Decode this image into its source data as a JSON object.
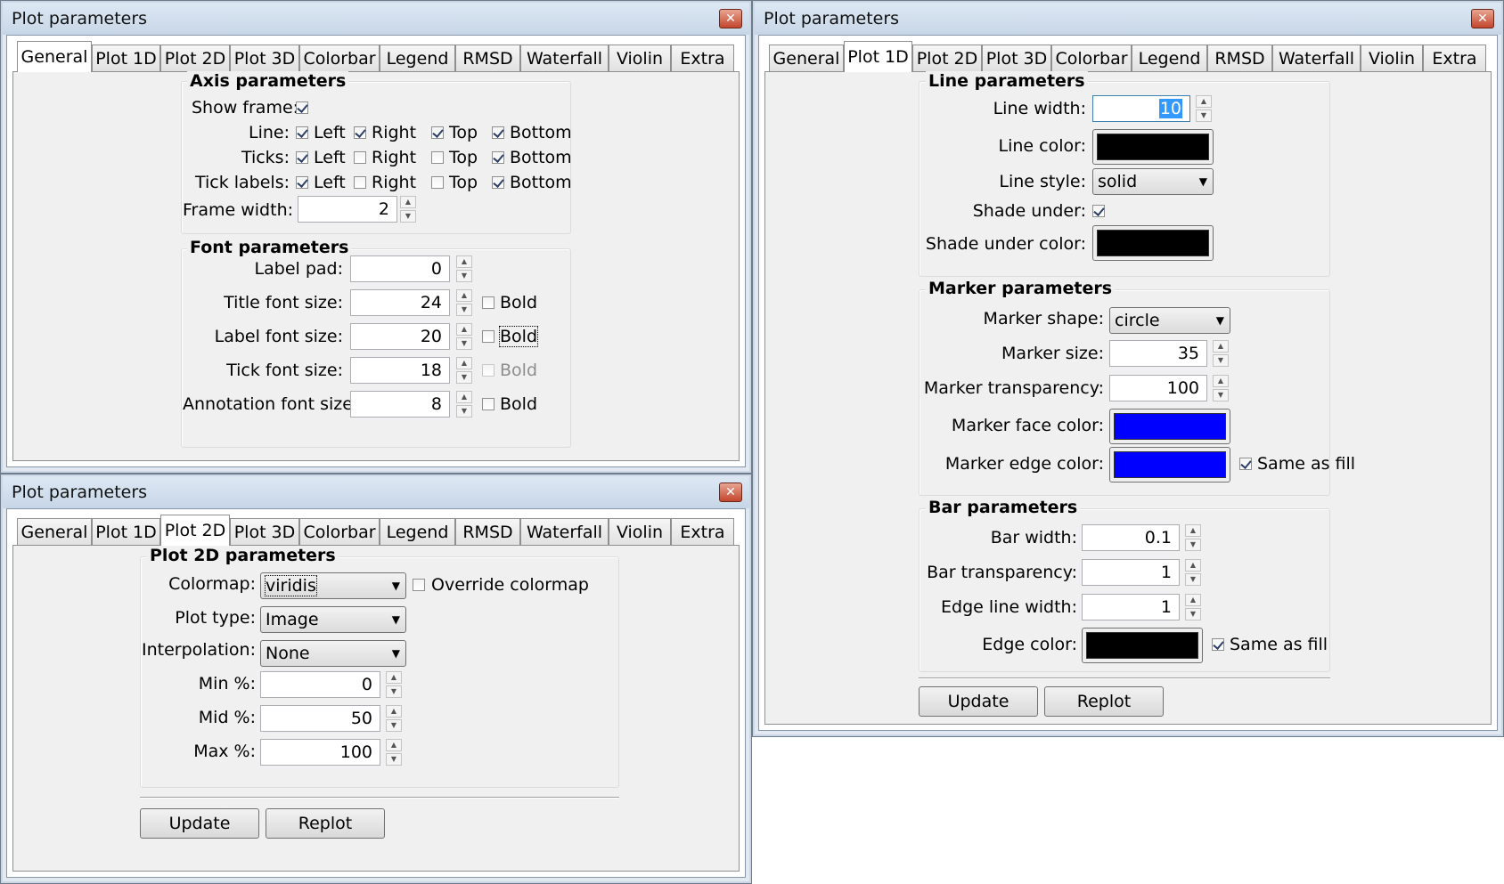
{
  "tabs": [
    "General",
    "Plot 1D",
    "Plot 2D",
    "Plot 3D",
    "Colorbar",
    "Legend",
    "RMSD",
    "Waterfall",
    "Violin",
    "Extra"
  ],
  "colors": {
    "black": "#000000",
    "blue": "#0000ff"
  },
  "window1": {
    "title": "Plot parameters",
    "axis": {
      "title": "Axis parameters",
      "show_frame_label": "Show frame:",
      "line_label": "Line:",
      "ticks_label": "Ticks:",
      "tick_labels_label": "Tick labels:",
      "left": "Left",
      "right": "Right",
      "top": "Top",
      "bottom": "Bottom",
      "frame_width_label": "Frame width:",
      "frame_width": "2",
      "show_frame": true,
      "line": [
        true,
        true,
        true,
        true
      ],
      "ticks": [
        true,
        false,
        false,
        true
      ],
      "tick_labels": [
        true,
        false,
        false,
        true
      ]
    },
    "font": {
      "title": "Font parameters",
      "label_pad_label": "Label pad:",
      "label_pad": "0",
      "title_font_label": "Title font size:",
      "title_font": "24",
      "label_font_label": "Label font size:",
      "label_font": "20",
      "tick_font_label": "Tick font size:",
      "tick_font": "18",
      "annotation_font_label": "Annotation font size:",
      "annotation_font": "8",
      "bold": "Bold"
    }
  },
  "window2": {
    "title": "Plot parameters",
    "group_title": "Plot 2D parameters",
    "colormap_label": "Colormap:",
    "colormap": "viridis",
    "override_label": "Override colormap",
    "plot_type_label": "Plot type:",
    "plot_type": "Image",
    "interp_label": "Interpolation:",
    "interp": "None",
    "min_label": "Min %:",
    "min": "0",
    "mid_label": "Mid %:",
    "mid": "50",
    "max_label": "Max %:",
    "max": "100",
    "update": "Update",
    "replot": "Replot"
  },
  "window3": {
    "title": "Plot parameters",
    "line": {
      "title": "Line parameters",
      "width_label": "Line width:",
      "width": "10",
      "color_label": "Line color:",
      "style_label": "Line style:",
      "style": "solid",
      "shade_label": "Shade under:",
      "shade_color_label": "Shade under color:"
    },
    "marker": {
      "title": "Marker parameters",
      "shape_label": "Marker shape:",
      "shape": "circle",
      "size_label": "Marker size:",
      "size": "35",
      "transp_label": "Marker transparency:",
      "transp": "100",
      "face_label": "Marker face color:",
      "edge_label": "Marker edge color:",
      "same_label": "Same as fill"
    },
    "bar": {
      "title": "Bar parameters",
      "width_label": "Bar width:",
      "width": "0.1",
      "transp_label": "Bar transparency:",
      "transp": "1",
      "edge_width_label": "Edge line width:",
      "edge_width": "1",
      "edge_color_label": "Edge color:",
      "same_label": "Same as fill"
    },
    "update": "Update",
    "replot": "Replot"
  }
}
